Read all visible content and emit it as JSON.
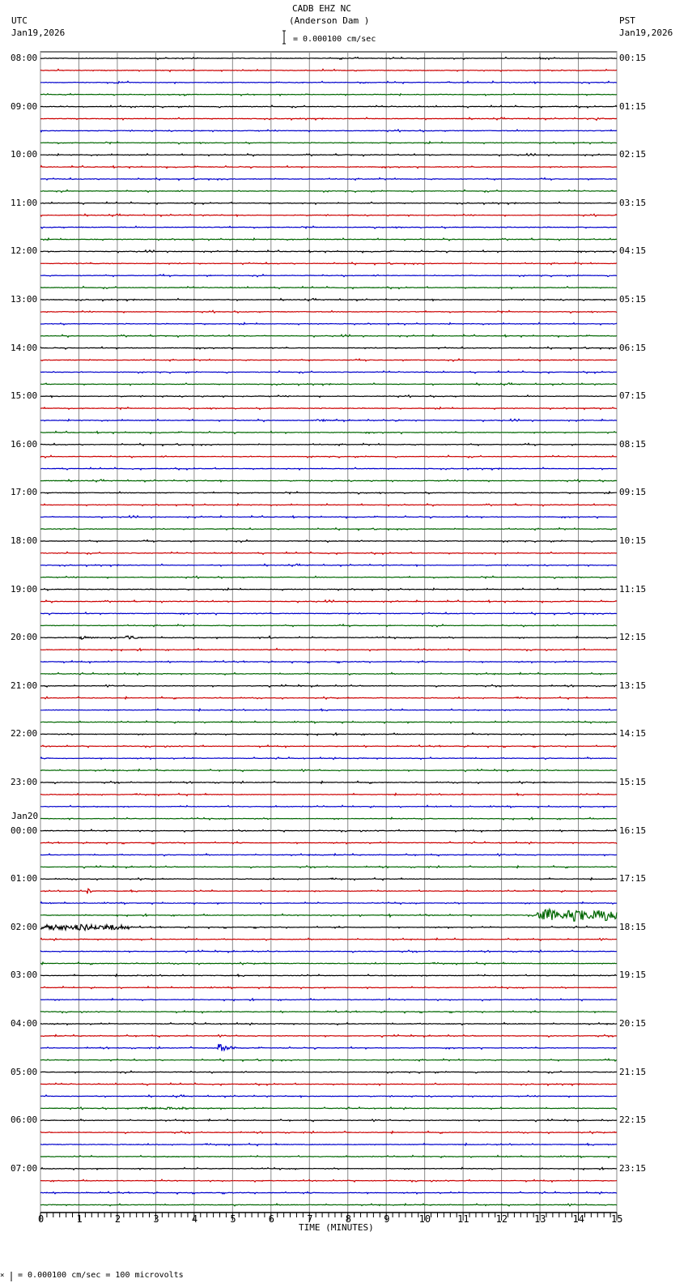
{
  "header": {
    "station": "CADB EHZ NC",
    "location": "(Anderson Dam )",
    "left_tz": "UTC",
    "left_date": "Jan19,2026",
    "right_tz": "PST",
    "right_date": "Jan19,2026",
    "scale_text": "= 0.000100 cm/sec"
  },
  "footer": {
    "scale_prefix": "×",
    "scale_text": "= 0.000100 cm/sec =     100 microvolts"
  },
  "chart_data": {
    "type": "line",
    "title": "CADB EHZ NC (Anderson Dam )",
    "xlabel": "TIME (MINUTES)",
    "xlim": [
      0,
      15
    ],
    "x_ticks": [
      "0",
      "1",
      "2",
      "3",
      "4",
      "5",
      "6",
      "7",
      "8",
      "9",
      "10",
      "11",
      "12",
      "13",
      "14",
      "15"
    ],
    "traces_per_hour": 4,
    "trace_count": 96,
    "trace_colors": [
      "#000000",
      "#cc0000",
      "#0000cc",
      "#006600"
    ],
    "date_change_label": "Jan20",
    "left_labels": [
      "08:00",
      "09:00",
      "10:00",
      "11:00",
      "12:00",
      "13:00",
      "14:00",
      "15:00",
      "16:00",
      "17:00",
      "18:00",
      "19:00",
      "20:00",
      "21:00",
      "22:00",
      "23:00",
      "00:00",
      "01:00",
      "02:00",
      "03:00",
      "04:00",
      "05:00",
      "06:00",
      "07:00"
    ],
    "right_labels": [
      "00:15",
      "01:15",
      "02:15",
      "03:15",
      "04:15",
      "05:15",
      "06:15",
      "07:15",
      "08:15",
      "09:15",
      "10:15",
      "11:15",
      "12:15",
      "13:15",
      "14:15",
      "15:15",
      "16:15",
      "17:15",
      "18:15",
      "19:15",
      "20:15",
      "21:15",
      "22:15",
      "23:15"
    ],
    "events": [
      {
        "trace": 2,
        "start": 8.3,
        "end": 8.7,
        "amp": 2
      },
      {
        "trace": 5,
        "start": 14.45,
        "end": 14.6,
        "amp": 7
      },
      {
        "trace": 30,
        "start": 7.2,
        "end": 7.9,
        "amp": 2
      },
      {
        "trace": 30,
        "start": 9.2,
        "end": 9.9,
        "amp": 1.5
      },
      {
        "trace": 48,
        "start": 1.0,
        "end": 1.6,
        "amp": 4
      },
      {
        "trace": 48,
        "start": 2.2,
        "end": 2.9,
        "amp": 3
      },
      {
        "trace": 48,
        "start": 5.95,
        "end": 6.2,
        "amp": 4
      },
      {
        "trace": 69,
        "start": 1.2,
        "end": 1.45,
        "amp": 6
      },
      {
        "trace": 71,
        "start": 8.3,
        "end": 8.4,
        "amp": 5
      },
      {
        "trace": 71,
        "start": 9.05,
        "end": 9.15,
        "amp": 5
      },
      {
        "trace": 71,
        "start": 12.9,
        "end": 15,
        "amp": 8
      },
      {
        "trace": 72,
        "start": 0,
        "end": 2.3,
        "amp": 4
      },
      {
        "trace": 82,
        "start": 4.6,
        "end": 5.3,
        "amp": 7
      },
      {
        "trace": 87,
        "start": 2.5,
        "end": 4.0,
        "amp": 1.5
      }
    ]
  }
}
